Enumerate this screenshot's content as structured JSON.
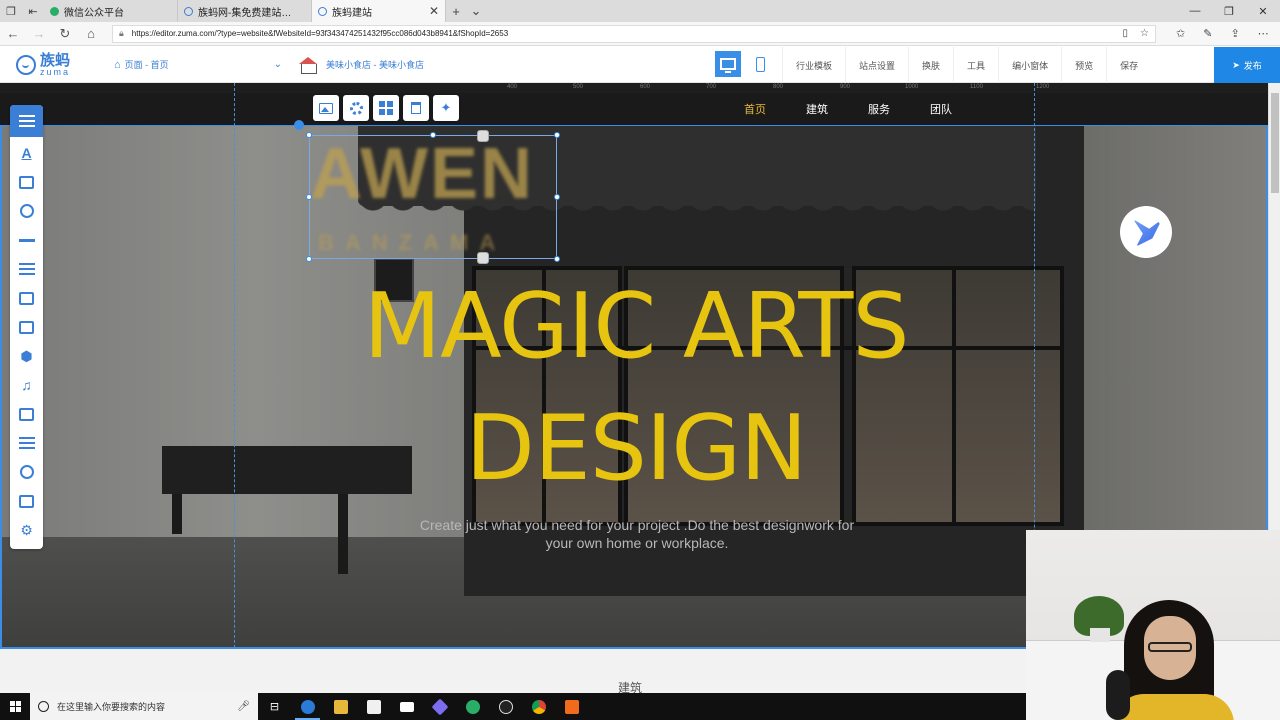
{
  "browser": {
    "tabs": [
      {
        "title": "微信公众平台",
        "icon": "wechat-icon"
      },
      {
        "title": "族蚂网-集免费建站、电商...",
        "icon": "zuma-icon"
      },
      {
        "title": "族蚂建站",
        "icon": "zuma-icon"
      }
    ],
    "url": "https://editor.zuma.com/?type=website&fWebsiteId=93f343474251432f95cc086d043b8941&fShopId=2653"
  },
  "editor": {
    "logo_cn": "族蚂",
    "logo_en": "zuma",
    "page_selector": "页面 - 首页",
    "store_selector": "美味小食店 - 美味小食店",
    "menu": [
      "行业模板",
      "站点设置",
      "换肤",
      "工具",
      "编小窗体",
      "预览",
      "保存"
    ],
    "publish_label": "发布"
  },
  "ruler": {
    "labels": [
      "400",
      "500",
      "600",
      "700",
      "800",
      "900",
      "1000",
      "1100",
      "1200"
    ]
  },
  "site": {
    "nav": [
      "首页",
      "建筑",
      "服务",
      "团队"
    ],
    "logo_big": "AWEN",
    "logo_small": "BANZAMA",
    "hero_title_line1": "MAGIC ARTS",
    "hero_title_line2": "DESIGN",
    "hero_subtitle": "Create just what you need for your project .Do the best designwork for your own home or workplace.",
    "next_section": "建筑"
  },
  "colors": {
    "accent": "#3a7fd5",
    "hero_title": "#e6c40f",
    "nav_active": "#e7b93a",
    "publish": "#1f87e5"
  },
  "taskbar": {
    "search_placeholder": "在这里输入你要搜索的内容"
  }
}
